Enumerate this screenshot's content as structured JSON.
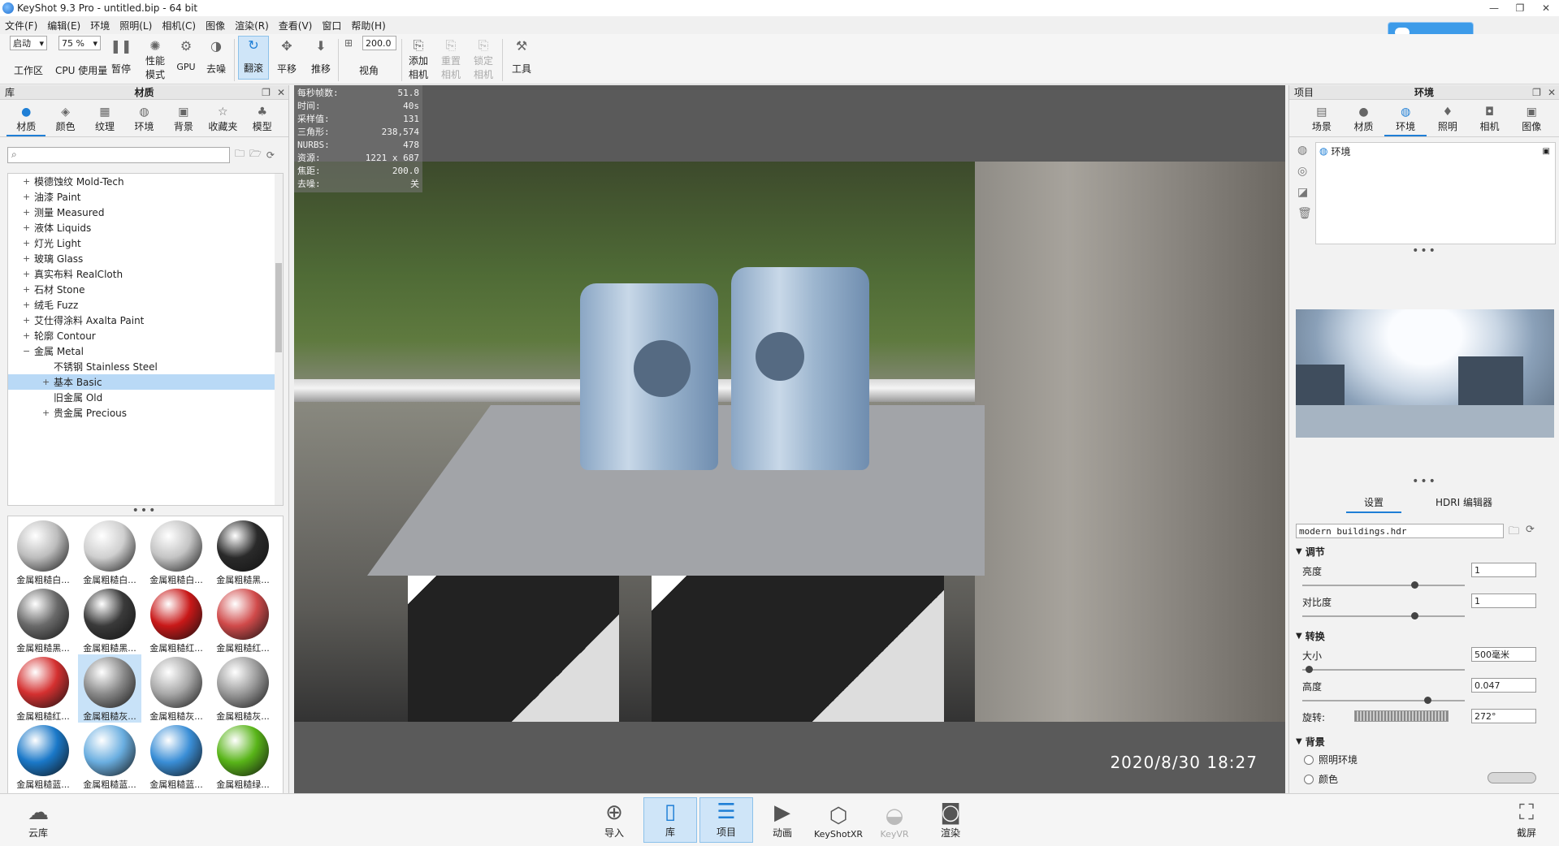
{
  "window": {
    "title": "KeyShot 9.3 Pro  - untitled.bip  - 64 bit",
    "minimize": "—",
    "restore": "❐",
    "close": "✕",
    "cloud_badge": ""
  },
  "menu": [
    "文件(F)",
    "编辑(E)",
    "环境",
    "照明(L)",
    "相机(C)",
    "图像",
    "渲染(R)",
    "查看(V)",
    "窗口",
    "帮助(H)"
  ],
  "toolbar": {
    "workspace_select": "启动",
    "workspace_label": "工作区",
    "cpu_select": "75 %",
    "cpu_label": "CPU 使用量",
    "pause": "暂停",
    "perf_mode": [
      "性能",
      "模式"
    ],
    "gpu": "GPU",
    "denoise": "去噪",
    "tumble": "翻滚",
    "pan": "平移",
    "dolly": "推移",
    "fov_value": "200.0",
    "fov_label": "视角",
    "add_camera": [
      "添加",
      "相机"
    ],
    "reset_camera": [
      "重置",
      "相机"
    ],
    "lock_camera": [
      "锁定",
      "相机"
    ],
    "tools": "工具"
  },
  "library": {
    "panel_left": "库",
    "title": "材质",
    "tabs": [
      "材质",
      "颜色",
      "纹理",
      "环境",
      "背景",
      "收藏夹",
      "模型"
    ],
    "search_placeholder": "",
    "tree": [
      {
        "label": "模德蚀纹 Mold-Tech",
        "exp": "+"
      },
      {
        "label": "油漆 Paint",
        "exp": "+"
      },
      {
        "label": "测量 Measured",
        "exp": "+"
      },
      {
        "label": "液体 Liquids",
        "exp": "+"
      },
      {
        "label": "灯光 Light",
        "exp": "+"
      },
      {
        "label": "玻璃 Glass",
        "exp": "+"
      },
      {
        "label": "真实布料 RealCloth",
        "exp": "+"
      },
      {
        "label": "石材 Stone",
        "exp": "+"
      },
      {
        "label": "绒毛 Fuzz",
        "exp": "+"
      },
      {
        "label": "艾仕得涂料 Axalta Paint",
        "exp": "+"
      },
      {
        "label": "轮廓 Contour",
        "exp": "+"
      },
      {
        "label": "金属 Metal",
        "exp": "−"
      },
      {
        "label": "不锈钢 Stainless Steel",
        "exp": "",
        "child": true
      },
      {
        "label": "基本 Basic",
        "exp": "+",
        "child": true,
        "selected": true
      },
      {
        "label": "旧金属 Old",
        "exp": "",
        "child": true
      },
      {
        "label": "贵金属 Precious",
        "exp": "+",
        "child": true
      }
    ],
    "materials": [
      {
        "label": "金属粗糙白...",
        "color": "#bdbdbd"
      },
      {
        "label": "金属粗糙白...",
        "color": "#cfcfcf"
      },
      {
        "label": "金属粗糙白...",
        "color": "#c4c4c4"
      },
      {
        "label": "金属粗糙黑...",
        "color": "#2a2a2a"
      },
      {
        "label": "金属粗糙黑...",
        "color": "#6a6a6a"
      },
      {
        "label": "金属粗糙黑...",
        "color": "#3a3a3a"
      },
      {
        "label": "金属粗糙红...",
        "color": "#c81818"
      },
      {
        "label": "金属粗糙红...",
        "color": "#d04a4a"
      },
      {
        "label": "金属粗糙红...",
        "color": "#d43030"
      },
      {
        "label": "金属粗糙灰...",
        "color": "#8a8a8a",
        "selected": true
      },
      {
        "label": "金属粗糙灰...",
        "color": "#a8a8a8"
      },
      {
        "label": "金属粗糙灰...",
        "color": "#9a9a9a"
      },
      {
        "label": "金属粗糙蓝...",
        "color": "#1a78c8"
      },
      {
        "label": "金属粗糙蓝...",
        "color": "#6aaee0"
      },
      {
        "label": "金属粗糙蓝...",
        "color": "#3a8ed6"
      },
      {
        "label": "金属粗糙绿...",
        "color": "#58b418"
      },
      {
        "label": "",
        "color": "#74c444"
      },
      {
        "label": "",
        "color": "#5aac2a"
      },
      {
        "label": "",
        "color": "#b4b4b4"
      },
      {
        "label": "",
        "color": "#c8c8c8"
      }
    ]
  },
  "viewport": {
    "stats": [
      {
        "k": "每秒帧数:",
        "v": "51.8"
      },
      {
        "k": "时间:",
        "v": "40s"
      },
      {
        "k": "采样值:",
        "v": "131"
      },
      {
        "k": "三角形:",
        "v": "238,574"
      },
      {
        "k": "NURBS:",
        "v": "478"
      },
      {
        "k": "资源:",
        "v": "1221 x 687"
      },
      {
        "k": "焦距:",
        "v": "200.0"
      },
      {
        "k": "去噪:",
        "v": "关"
      }
    ],
    "timestamp": "2020/8/30  18:27"
  },
  "project": {
    "panel_left": "项目",
    "title": "环境",
    "tabs": [
      "场景",
      "材质",
      "环境",
      "照明",
      "相机",
      "图像"
    ],
    "env_item": "环境",
    "sub_tabs": [
      "设置",
      "HDRI 编辑器"
    ],
    "hdr_file": "modern buildings.hdr",
    "sections": {
      "adjust": "调节",
      "brightness_label": "亮度",
      "brightness": "1",
      "contrast_label": "对比度",
      "contrast": "1",
      "transform": "转换",
      "size_label": "大小",
      "size": "500毫米",
      "height_label": "高度",
      "height": "0.047",
      "rotation_label": "旋转:",
      "rotation": "272°",
      "background": "背景",
      "bg_lighting": "照明环境",
      "bg_color": "颜色"
    }
  },
  "bottombar": {
    "cloud": "云库",
    "import": "导入",
    "library": "库",
    "project": "项目",
    "animation": "动画",
    "keyshotxr": "KeyShotXR",
    "keyvr": "KeyVR",
    "render": "渲染",
    "screenshot": "截屏"
  }
}
